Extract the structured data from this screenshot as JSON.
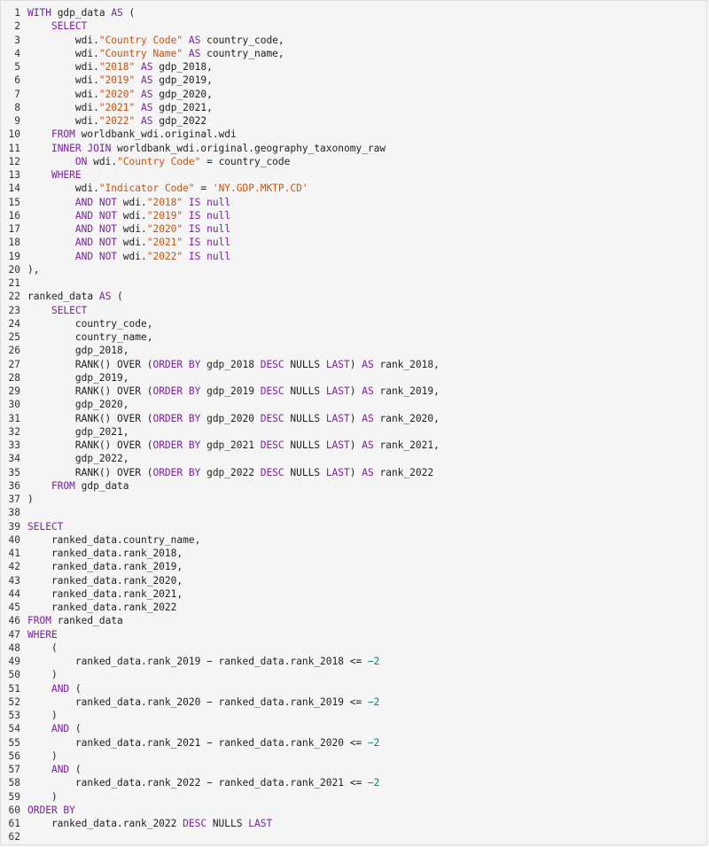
{
  "editor": {
    "lines": [
      [
        {
          "t": "WITH",
          "k": "kw"
        },
        {
          "t": " gdp_data ",
          "k": ""
        },
        {
          "t": "AS",
          "k": "kw"
        },
        {
          "t": " (",
          "k": ""
        }
      ],
      [
        {
          "t": "    ",
          "k": ""
        },
        {
          "t": "SELECT",
          "k": "kw"
        }
      ],
      [
        {
          "t": "        wdi.",
          "k": ""
        },
        {
          "t": "\"Country Code\"",
          "k": "str"
        },
        {
          "t": " ",
          "k": ""
        },
        {
          "t": "AS",
          "k": "kw"
        },
        {
          "t": " country_code,",
          "k": ""
        }
      ],
      [
        {
          "t": "        wdi.",
          "k": ""
        },
        {
          "t": "\"Country Name\"",
          "k": "str"
        },
        {
          "t": " ",
          "k": ""
        },
        {
          "t": "AS",
          "k": "kw"
        },
        {
          "t": " country_name,",
          "k": ""
        }
      ],
      [
        {
          "t": "        wdi.",
          "k": ""
        },
        {
          "t": "\"2018\"",
          "k": "str"
        },
        {
          "t": " ",
          "k": ""
        },
        {
          "t": "AS",
          "k": "kw"
        },
        {
          "t": " gdp_2018,",
          "k": ""
        }
      ],
      [
        {
          "t": "        wdi.",
          "k": ""
        },
        {
          "t": "\"2019\"",
          "k": "str"
        },
        {
          "t": " ",
          "k": ""
        },
        {
          "t": "AS",
          "k": "kw"
        },
        {
          "t": " gdp_2019,",
          "k": ""
        }
      ],
      [
        {
          "t": "        wdi.",
          "k": ""
        },
        {
          "t": "\"2020\"",
          "k": "str"
        },
        {
          "t": " ",
          "k": ""
        },
        {
          "t": "AS",
          "k": "kw"
        },
        {
          "t": " gdp_2020,",
          "k": ""
        }
      ],
      [
        {
          "t": "        wdi.",
          "k": ""
        },
        {
          "t": "\"2021\"",
          "k": "str"
        },
        {
          "t": " ",
          "k": ""
        },
        {
          "t": "AS",
          "k": "kw"
        },
        {
          "t": " gdp_2021,",
          "k": ""
        }
      ],
      [
        {
          "t": "        wdi.",
          "k": ""
        },
        {
          "t": "\"2022\"",
          "k": "str"
        },
        {
          "t": " ",
          "k": ""
        },
        {
          "t": "AS",
          "k": "kw"
        },
        {
          "t": " gdp_2022",
          "k": ""
        }
      ],
      [
        {
          "t": "    ",
          "k": ""
        },
        {
          "t": "FROM",
          "k": "kw"
        },
        {
          "t": " worldbank_wdi.original.wdi",
          "k": ""
        }
      ],
      [
        {
          "t": "    ",
          "k": ""
        },
        {
          "t": "INNER JOIN",
          "k": "kw"
        },
        {
          "t": " worldbank_wdi.original.geography_taxonomy_raw",
          "k": ""
        }
      ],
      [
        {
          "t": "        ",
          "k": ""
        },
        {
          "t": "ON",
          "k": "kw"
        },
        {
          "t": " wdi.",
          "k": ""
        },
        {
          "t": "\"Country Code\"",
          "k": "str"
        },
        {
          "t": " = country_code",
          "k": ""
        }
      ],
      [
        {
          "t": "    ",
          "k": ""
        },
        {
          "t": "WHERE",
          "k": "kw"
        }
      ],
      [
        {
          "t": "        wdi.",
          "k": ""
        },
        {
          "t": "\"Indicator Code\"",
          "k": "str"
        },
        {
          "t": " = ",
          "k": ""
        },
        {
          "t": "'NY.GDP.MKTP.CD'",
          "k": "strsq"
        }
      ],
      [
        {
          "t": "        ",
          "k": ""
        },
        {
          "t": "AND NOT",
          "k": "kw"
        },
        {
          "t": " wdi.",
          "k": ""
        },
        {
          "t": "\"2018\"",
          "k": "str"
        },
        {
          "t": " ",
          "k": ""
        },
        {
          "t": "IS",
          "k": "kw"
        },
        {
          "t": " ",
          "k": ""
        },
        {
          "t": "null",
          "k": "kw"
        }
      ],
      [
        {
          "t": "        ",
          "k": ""
        },
        {
          "t": "AND NOT",
          "k": "kw"
        },
        {
          "t": " wdi.",
          "k": ""
        },
        {
          "t": "\"2019\"",
          "k": "str"
        },
        {
          "t": " ",
          "k": ""
        },
        {
          "t": "IS",
          "k": "kw"
        },
        {
          "t": " ",
          "k": ""
        },
        {
          "t": "null",
          "k": "kw"
        }
      ],
      [
        {
          "t": "        ",
          "k": ""
        },
        {
          "t": "AND NOT",
          "k": "kw"
        },
        {
          "t": " wdi.",
          "k": ""
        },
        {
          "t": "\"2020\"",
          "k": "str"
        },
        {
          "t": " ",
          "k": ""
        },
        {
          "t": "IS",
          "k": "kw"
        },
        {
          "t": " ",
          "k": ""
        },
        {
          "t": "null",
          "k": "kw"
        }
      ],
      [
        {
          "t": "        ",
          "k": ""
        },
        {
          "t": "AND NOT",
          "k": "kw"
        },
        {
          "t": " wdi.",
          "k": ""
        },
        {
          "t": "\"2021\"",
          "k": "str"
        },
        {
          "t": " ",
          "k": ""
        },
        {
          "t": "IS",
          "k": "kw"
        },
        {
          "t": " ",
          "k": ""
        },
        {
          "t": "null",
          "k": "kw"
        }
      ],
      [
        {
          "t": "        ",
          "k": ""
        },
        {
          "t": "AND NOT",
          "k": "kw"
        },
        {
          "t": " wdi.",
          "k": ""
        },
        {
          "t": "\"2022\"",
          "k": "str"
        },
        {
          "t": " ",
          "k": ""
        },
        {
          "t": "IS",
          "k": "kw"
        },
        {
          "t": " ",
          "k": ""
        },
        {
          "t": "null",
          "k": "kw"
        }
      ],
      [
        {
          "t": "),",
          "k": ""
        }
      ],
      [
        {
          "t": "",
          "k": ""
        }
      ],
      [
        {
          "t": "ranked_data ",
          "k": ""
        },
        {
          "t": "AS",
          "k": "kw"
        },
        {
          "t": " (",
          "k": ""
        }
      ],
      [
        {
          "t": "    ",
          "k": ""
        },
        {
          "t": "SELECT",
          "k": "kw"
        }
      ],
      [
        {
          "t": "        country_code,",
          "k": ""
        }
      ],
      [
        {
          "t": "        country_name,",
          "k": ""
        }
      ],
      [
        {
          "t": "        gdp_2018,",
          "k": ""
        }
      ],
      [
        {
          "t": "        RANK() OVER (",
          "k": ""
        },
        {
          "t": "ORDER BY",
          "k": "kw"
        },
        {
          "t": " gdp_2018 ",
          "k": ""
        },
        {
          "t": "DESC",
          "k": "kw"
        },
        {
          "t": " NULLS ",
          "k": ""
        },
        {
          "t": "LAST",
          "k": "kw"
        },
        {
          "t": ") ",
          "k": ""
        },
        {
          "t": "AS",
          "k": "kw"
        },
        {
          "t": " rank_2018,",
          "k": ""
        }
      ],
      [
        {
          "t": "        gdp_2019,",
          "k": ""
        }
      ],
      [
        {
          "t": "        RANK() OVER (",
          "k": ""
        },
        {
          "t": "ORDER BY",
          "k": "kw"
        },
        {
          "t": " gdp_2019 ",
          "k": ""
        },
        {
          "t": "DESC",
          "k": "kw"
        },
        {
          "t": " NULLS ",
          "k": ""
        },
        {
          "t": "LAST",
          "k": "kw"
        },
        {
          "t": ") ",
          "k": ""
        },
        {
          "t": "AS",
          "k": "kw"
        },
        {
          "t": " rank_2019,",
          "k": ""
        }
      ],
      [
        {
          "t": "        gdp_2020,",
          "k": ""
        }
      ],
      [
        {
          "t": "        RANK() OVER (",
          "k": ""
        },
        {
          "t": "ORDER BY",
          "k": "kw"
        },
        {
          "t": " gdp_2020 ",
          "k": ""
        },
        {
          "t": "DESC",
          "k": "kw"
        },
        {
          "t": " NULLS ",
          "k": ""
        },
        {
          "t": "LAST",
          "k": "kw"
        },
        {
          "t": ") ",
          "k": ""
        },
        {
          "t": "AS",
          "k": "kw"
        },
        {
          "t": " rank_2020,",
          "k": ""
        }
      ],
      [
        {
          "t": "        gdp_2021,",
          "k": ""
        }
      ],
      [
        {
          "t": "        RANK() OVER (",
          "k": ""
        },
        {
          "t": "ORDER BY",
          "k": "kw"
        },
        {
          "t": " gdp_2021 ",
          "k": ""
        },
        {
          "t": "DESC",
          "k": "kw"
        },
        {
          "t": " NULLS ",
          "k": ""
        },
        {
          "t": "LAST",
          "k": "kw"
        },
        {
          "t": ") ",
          "k": ""
        },
        {
          "t": "AS",
          "k": "kw"
        },
        {
          "t": " rank_2021,",
          "k": ""
        }
      ],
      [
        {
          "t": "        gdp_2022,",
          "k": ""
        }
      ],
      [
        {
          "t": "        RANK() OVER (",
          "k": ""
        },
        {
          "t": "ORDER BY",
          "k": "kw"
        },
        {
          "t": " gdp_2022 ",
          "k": ""
        },
        {
          "t": "DESC",
          "k": "kw"
        },
        {
          "t": " NULLS ",
          "k": ""
        },
        {
          "t": "LAST",
          "k": "kw"
        },
        {
          "t": ") ",
          "k": ""
        },
        {
          "t": "AS",
          "k": "kw"
        },
        {
          "t": " rank_2022",
          "k": ""
        }
      ],
      [
        {
          "t": "    ",
          "k": ""
        },
        {
          "t": "FROM",
          "k": "kw"
        },
        {
          "t": " gdp_data",
          "k": ""
        }
      ],
      [
        {
          "t": ")",
          "k": ""
        }
      ],
      [
        {
          "t": "",
          "k": ""
        }
      ],
      [
        {
          "t": "SELECT",
          "k": "kw"
        }
      ],
      [
        {
          "t": "    ranked_data.country_name,",
          "k": ""
        }
      ],
      [
        {
          "t": "    ranked_data.rank_2018,",
          "k": ""
        }
      ],
      [
        {
          "t": "    ranked_data.rank_2019,",
          "k": ""
        }
      ],
      [
        {
          "t": "    ranked_data.rank_2020,",
          "k": ""
        }
      ],
      [
        {
          "t": "    ranked_data.rank_2021,",
          "k": ""
        }
      ],
      [
        {
          "t": "    ranked_data.rank_2022",
          "k": ""
        }
      ],
      [
        {
          "t": "FROM",
          "k": "kw"
        },
        {
          "t": " ranked_data",
          "k": ""
        }
      ],
      [
        {
          "t": "WHERE",
          "k": "kw"
        }
      ],
      [
        {
          "t": "    (",
          "k": ""
        }
      ],
      [
        {
          "t": "        ranked_data.rank_2019 − ranked_data.rank_2018 <= ",
          "k": ""
        },
        {
          "t": "−2",
          "k": "num"
        }
      ],
      [
        {
          "t": "    )",
          "k": ""
        }
      ],
      [
        {
          "t": "    ",
          "k": ""
        },
        {
          "t": "AND",
          "k": "kw"
        },
        {
          "t": " (",
          "k": ""
        }
      ],
      [
        {
          "t": "        ranked_data.rank_2020 − ranked_data.rank_2019 <= ",
          "k": ""
        },
        {
          "t": "−2",
          "k": "num"
        }
      ],
      [
        {
          "t": "    )",
          "k": ""
        }
      ],
      [
        {
          "t": "    ",
          "k": ""
        },
        {
          "t": "AND",
          "k": "kw"
        },
        {
          "t": " (",
          "k": ""
        }
      ],
      [
        {
          "t": "        ranked_data.rank_2021 − ranked_data.rank_2020 <= ",
          "k": ""
        },
        {
          "t": "−2",
          "k": "num"
        }
      ],
      [
        {
          "t": "    )",
          "k": ""
        }
      ],
      [
        {
          "t": "    ",
          "k": ""
        },
        {
          "t": "AND",
          "k": "kw"
        },
        {
          "t": " (",
          "k": ""
        }
      ],
      [
        {
          "t": "        ranked_data.rank_2022 − ranked_data.rank_2021 <= ",
          "k": ""
        },
        {
          "t": "−2",
          "k": "num"
        }
      ],
      [
        {
          "t": "    )",
          "k": ""
        }
      ],
      [
        {
          "t": "ORDER BY",
          "k": "kw"
        }
      ],
      [
        {
          "t": "    ranked_data.rank_2022 ",
          "k": ""
        },
        {
          "t": "DESC",
          "k": "kw"
        },
        {
          "t": " NULLS ",
          "k": ""
        },
        {
          "t": "LAST",
          "k": "kw"
        }
      ],
      [
        {
          "t": "",
          "k": ""
        }
      ]
    ],
    "colors": {
      "keyword": "#7a1fa0",
      "string": "#c9510c",
      "number": "#0f7b6b",
      "text": "#1f1f1f",
      "background": "#f5f5f5"
    }
  }
}
